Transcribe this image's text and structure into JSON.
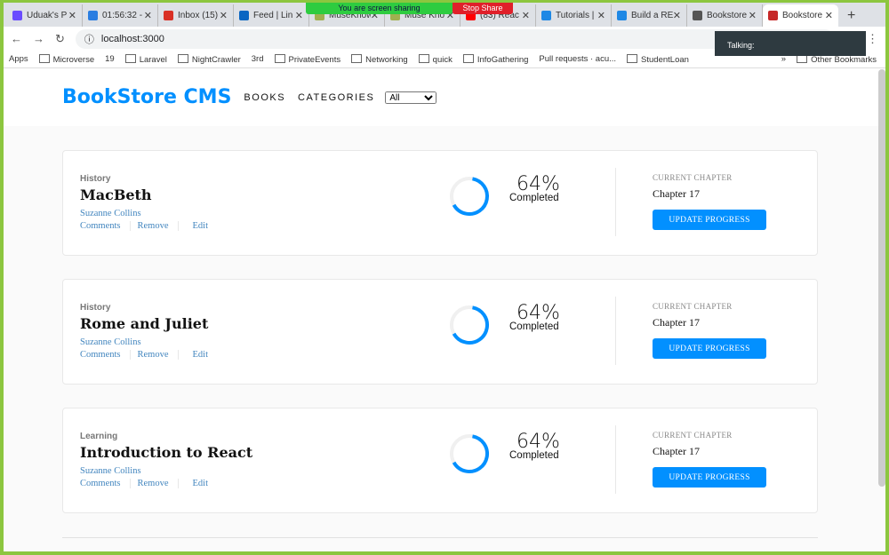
{
  "browser": {
    "tabs": [
      {
        "label": "Uduak's P",
        "color": "#6a4cff"
      },
      {
        "label": "01:56:32 -",
        "color": "#2a7de1"
      },
      {
        "label": "Inbox (15)",
        "color": "#d93025"
      },
      {
        "label": "Feed | Lin",
        "color": "#0a66c2"
      },
      {
        "label": "MuseKnow",
        "color": "#a0b050"
      },
      {
        "label": "Muse Kno",
        "color": "#a0b050"
      },
      {
        "label": "(83) Reac",
        "color": "#ff0000"
      },
      {
        "label": "Tutorials |",
        "color": "#1e88e5"
      },
      {
        "label": "Build a RE",
        "color": "#1e88e5"
      },
      {
        "label": "Bookstore",
        "color": "#555555"
      },
      {
        "label": "Bookstore",
        "color": "#c62828"
      }
    ],
    "share_text": "You are screen sharing",
    "stop_share": "Stop Share",
    "url": "localhost:3000",
    "talking": "Talking:",
    "bookmarks": [
      "Apps",
      "Microverse",
      "19",
      "Laravel",
      "NightCrawler",
      "3rd",
      "PrivateEvents",
      "Networking",
      "quick",
      "InfoGathering",
      "Pull requests · acu...",
      "StudentLoan"
    ],
    "bookmarks_more": "»",
    "other_bookmarks": "Other Bookmarks"
  },
  "header": {
    "logo": "BookStore CMS",
    "nav": [
      "BOOKS",
      "CATEGORIES"
    ],
    "filter": "All"
  },
  "accent": "#0290ff",
  "books": [
    {
      "genre": "History",
      "title": "MacBeth",
      "author": "Suzanne Collins",
      "progress": "64%",
      "progress_value": 64,
      "completed": "Completed",
      "current_chapter_label": "CURRENT CHAPTER",
      "chapter": "Chapter 17",
      "button": "UPDATE PROGRESS",
      "actions": [
        "Comments",
        "Remove",
        "Edit"
      ]
    },
    {
      "genre": "History",
      "title": "Rome and Juliet",
      "author": "Suzanne Collins",
      "progress": "64%",
      "progress_value": 64,
      "completed": "Completed",
      "current_chapter_label": "CURRENT CHAPTER",
      "chapter": "Chapter 17",
      "button": "UPDATE PROGRESS",
      "actions": [
        "Comments",
        "Remove",
        "Edit"
      ]
    },
    {
      "genre": "Learning",
      "title": "Introduction to React",
      "author": "Suzanne Collins",
      "progress": "64%",
      "progress_value": 64,
      "completed": "Completed",
      "current_chapter_label": "CURRENT CHAPTER",
      "chapter": "Chapter 17",
      "button": "UPDATE PROGRESS",
      "actions": [
        "Comments",
        "Remove",
        "Edit"
      ]
    }
  ]
}
